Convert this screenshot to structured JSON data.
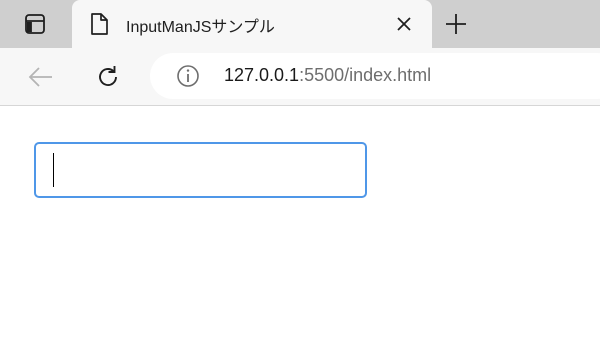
{
  "browser": {
    "tab": {
      "title": "InputManJSサンプル"
    },
    "address": {
      "host": "127.0.0.1",
      "rest": ":5500/index.html"
    }
  },
  "page": {
    "input": {
      "value": ""
    }
  },
  "colors": {
    "tabstrip": "#cfcfcf",
    "toolbar": "#f7f7f7",
    "input_focus_border": "#4f97e8"
  },
  "icons": {
    "tab_actions": "tab-actions-icon",
    "page": "page-icon",
    "close": "close-icon",
    "new_tab": "plus-icon",
    "back": "back-arrow-icon",
    "reload": "reload-icon",
    "site_info": "info-icon"
  }
}
